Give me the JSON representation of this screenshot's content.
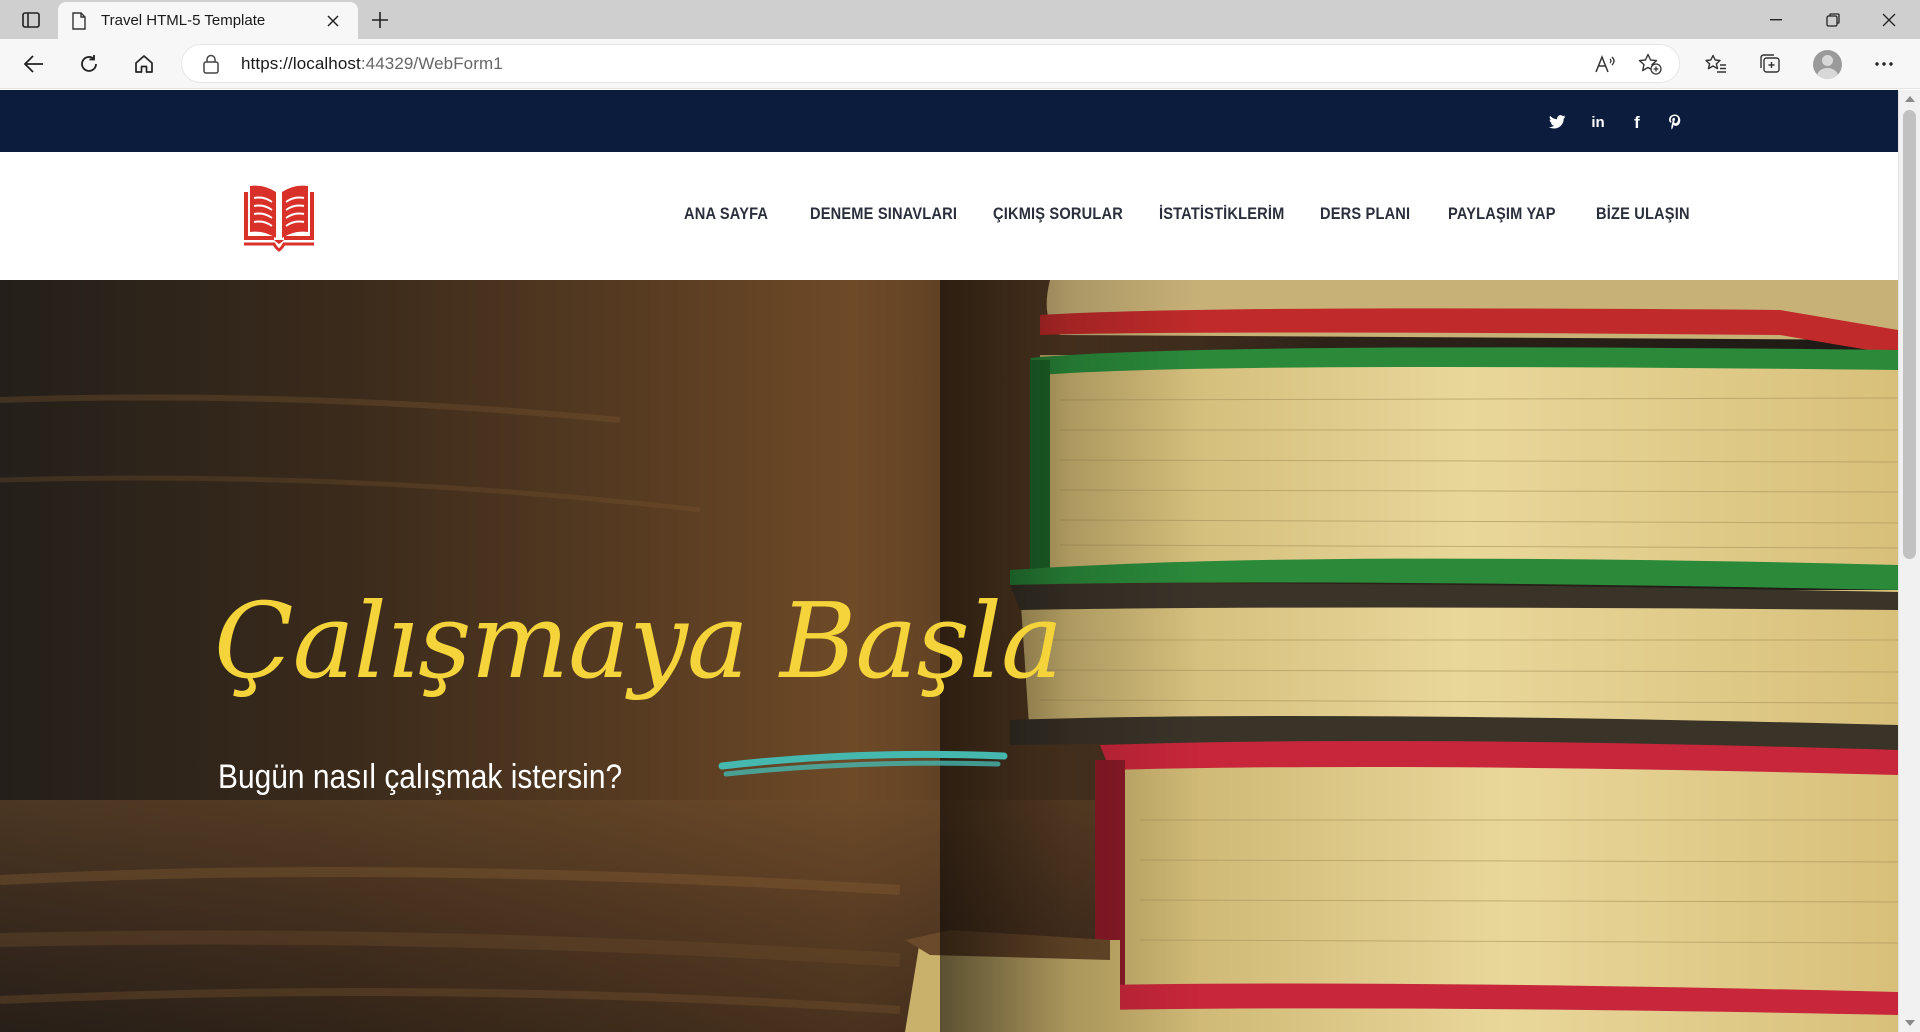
{
  "browser": {
    "tab_title": "Travel HTML-5 Template",
    "url_host": "https://localhost",
    "url_rest": ":44329/WebForm1"
  },
  "site": {
    "nav": [
      "ANA SAYFA",
      "DENEME SINAVLARI",
      "ÇIKMIŞ SORULAR",
      "İSTATİSTİKLERİM",
      "DERS PLANI",
      "PAYLAŞIM YAP",
      "BİZE ULAŞIN"
    ],
    "social_icons": [
      "twitter-icon",
      "linkedin-icon",
      "facebook-icon",
      "pinterest-icon"
    ],
    "hero": {
      "title": "Çalışmaya Başla",
      "subtitle": "Bugün nasıl çalışmak istersin?"
    }
  },
  "colors": {
    "topbar": "#0b1c3d",
    "logo_red": "#d9302a",
    "hero_title": "#f4d43a",
    "brush_teal": "#45b8b0"
  }
}
